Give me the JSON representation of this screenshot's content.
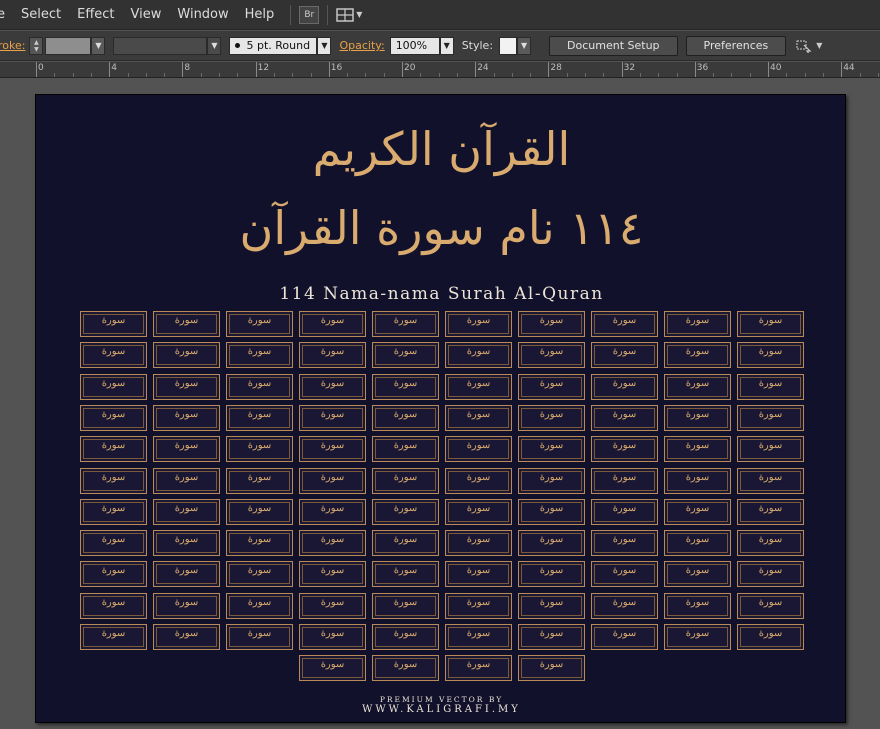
{
  "menubar": {
    "items": [
      "e",
      "Select",
      "Effect",
      "View",
      "Window",
      "Help"
    ],
    "bridge_label": "Br",
    "arrange_icon": "arrange-documents-icon"
  },
  "controlbar": {
    "stroke_label": "roke:",
    "stroke_weight": "5 pt. Round",
    "opacity_label": "Opacity:",
    "opacity_value": "100%",
    "style_label": "Style:",
    "document_setup": "Document Setup",
    "preferences": "Preferences"
  },
  "ruler": {
    "labels": [
      "0",
      "4",
      "8",
      "12",
      "16",
      "20",
      "24",
      "28",
      "32",
      "36",
      "40",
      "44"
    ]
  },
  "artwork": {
    "title_arabic": "القرآن الكريم",
    "number_arabic": "١١٤ نام سورة القرآن",
    "subtitle": "114 Nama-nama Surah Al-Quran",
    "credit_line1": "PREMIUM VECTOR BY",
    "credit_line2": "WWW.KALIGRAFI.MY",
    "tile_arabic": "سورة",
    "tile_count": 114,
    "tiles_per_row": 10
  },
  "colors": {
    "artboard": "#12112c",
    "gold": "#d9ab6e",
    "ui_dark": "#323232",
    "accent_orange": "#e8a14a"
  }
}
